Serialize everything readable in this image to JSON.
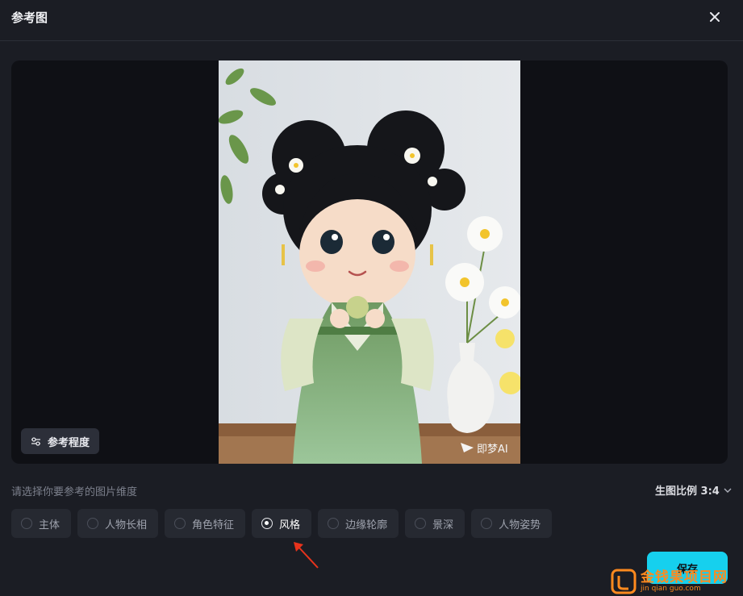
{
  "header": {
    "title": "参考图"
  },
  "preview": {
    "image_watermark": "即梦AI",
    "reference_button_label": "参考程度"
  },
  "hint": "请选择你要参考的图片维度",
  "ratio": {
    "label": "生图比例 3:4"
  },
  "options": [
    {
      "label": "主体",
      "selected": false
    },
    {
      "label": "人物长相",
      "selected": false
    },
    {
      "label": "角色特征",
      "selected": false
    },
    {
      "label": "风格",
      "selected": true
    },
    {
      "label": "边缘轮廓",
      "selected": false
    },
    {
      "label": "景深",
      "selected": false
    },
    {
      "label": "人物姿势",
      "selected": false
    }
  ],
  "save_label": "保存",
  "watermark": {
    "main": "金钱果项目网",
    "sub": "jin qian guo.com"
  },
  "colors": {
    "accent": "#16d0ee",
    "background": "#1b1d24",
    "annotation_arrow": "#e8331c"
  }
}
